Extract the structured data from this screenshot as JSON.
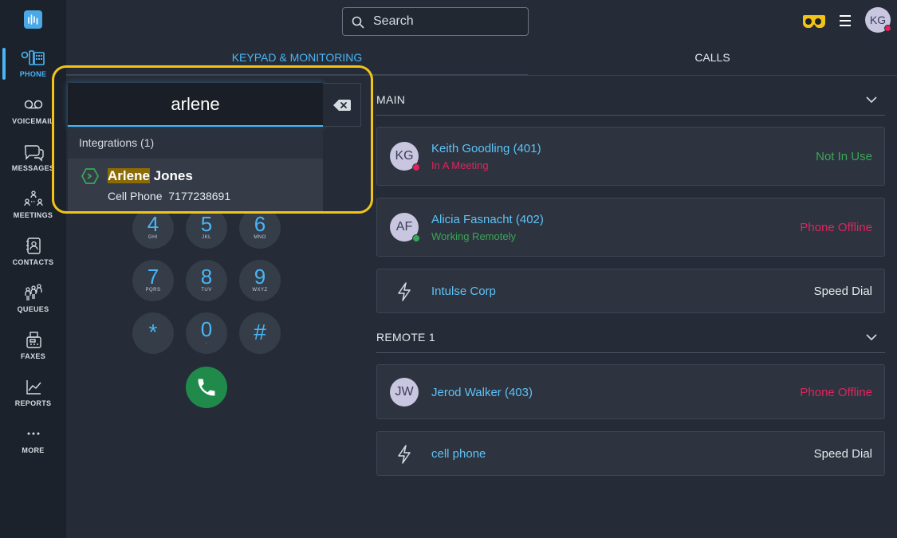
{
  "sidebar": {
    "items": [
      {
        "label": "PHONE",
        "icon": "phone-icon"
      },
      {
        "label": "VOICEMAIL",
        "icon": "voicemail-icon"
      },
      {
        "label": "MESSAGES",
        "icon": "messages-icon"
      },
      {
        "label": "MEETINGS",
        "icon": "meetings-icon"
      },
      {
        "label": "CONTACTS",
        "icon": "contacts-icon"
      },
      {
        "label": "QUEUES",
        "icon": "queues-icon"
      },
      {
        "label": "FAXES",
        "icon": "fax-icon"
      },
      {
        "label": "REPORTS",
        "icon": "reports-icon"
      },
      {
        "label": "MORE",
        "icon": "more-icon"
      }
    ]
  },
  "header": {
    "search_placeholder": "Search",
    "user_initials": "KG"
  },
  "tabs": {
    "keypad": "KEYPAD & MONITORING",
    "calls": "CALLS"
  },
  "dialer": {
    "input_value": "arlene",
    "results_header": "Integrations (1)",
    "result": {
      "name_highlight": "Arlene",
      "name_rest": " Jones",
      "detail": "Cell Phone  7177238691"
    },
    "keys": [
      {
        "digit": "4",
        "letters": "GHI"
      },
      {
        "digit": "5",
        "letters": "JKL"
      },
      {
        "digit": "6",
        "letters": "MNO"
      },
      {
        "digit": "7",
        "letters": "PQRS"
      },
      {
        "digit": "8",
        "letters": "TUV"
      },
      {
        "digit": "9",
        "letters": "WXYZ"
      },
      {
        "digit": "*",
        "letters": ""
      },
      {
        "digit": "0",
        "letters": "."
      },
      {
        "digit": "#",
        "letters": ""
      }
    ]
  },
  "monitoring": {
    "groups": [
      {
        "title": "MAIN"
      },
      {
        "title": "REMOTE 1"
      }
    ],
    "main": [
      {
        "initials": "KG",
        "name": "Keith Goodling (401)",
        "sub": "In A Meeting",
        "status": "Not In Use"
      },
      {
        "initials": "AF",
        "name": "Alicia Fasnacht (402)",
        "sub": "Working Remotely",
        "status": "Phone Offline"
      },
      {
        "name": "Intulse Corp",
        "status": "Speed Dial"
      }
    ],
    "remote": [
      {
        "initials": "JW",
        "name": "Jerod Walker (403)",
        "status": "Phone Offline"
      },
      {
        "name": "cell phone",
        "status": "Speed Dial"
      }
    ]
  },
  "colors": {
    "accent": "#49b5f5",
    "busy": "#e0245e",
    "available": "#3aa657",
    "highlight": "#f2c418"
  }
}
